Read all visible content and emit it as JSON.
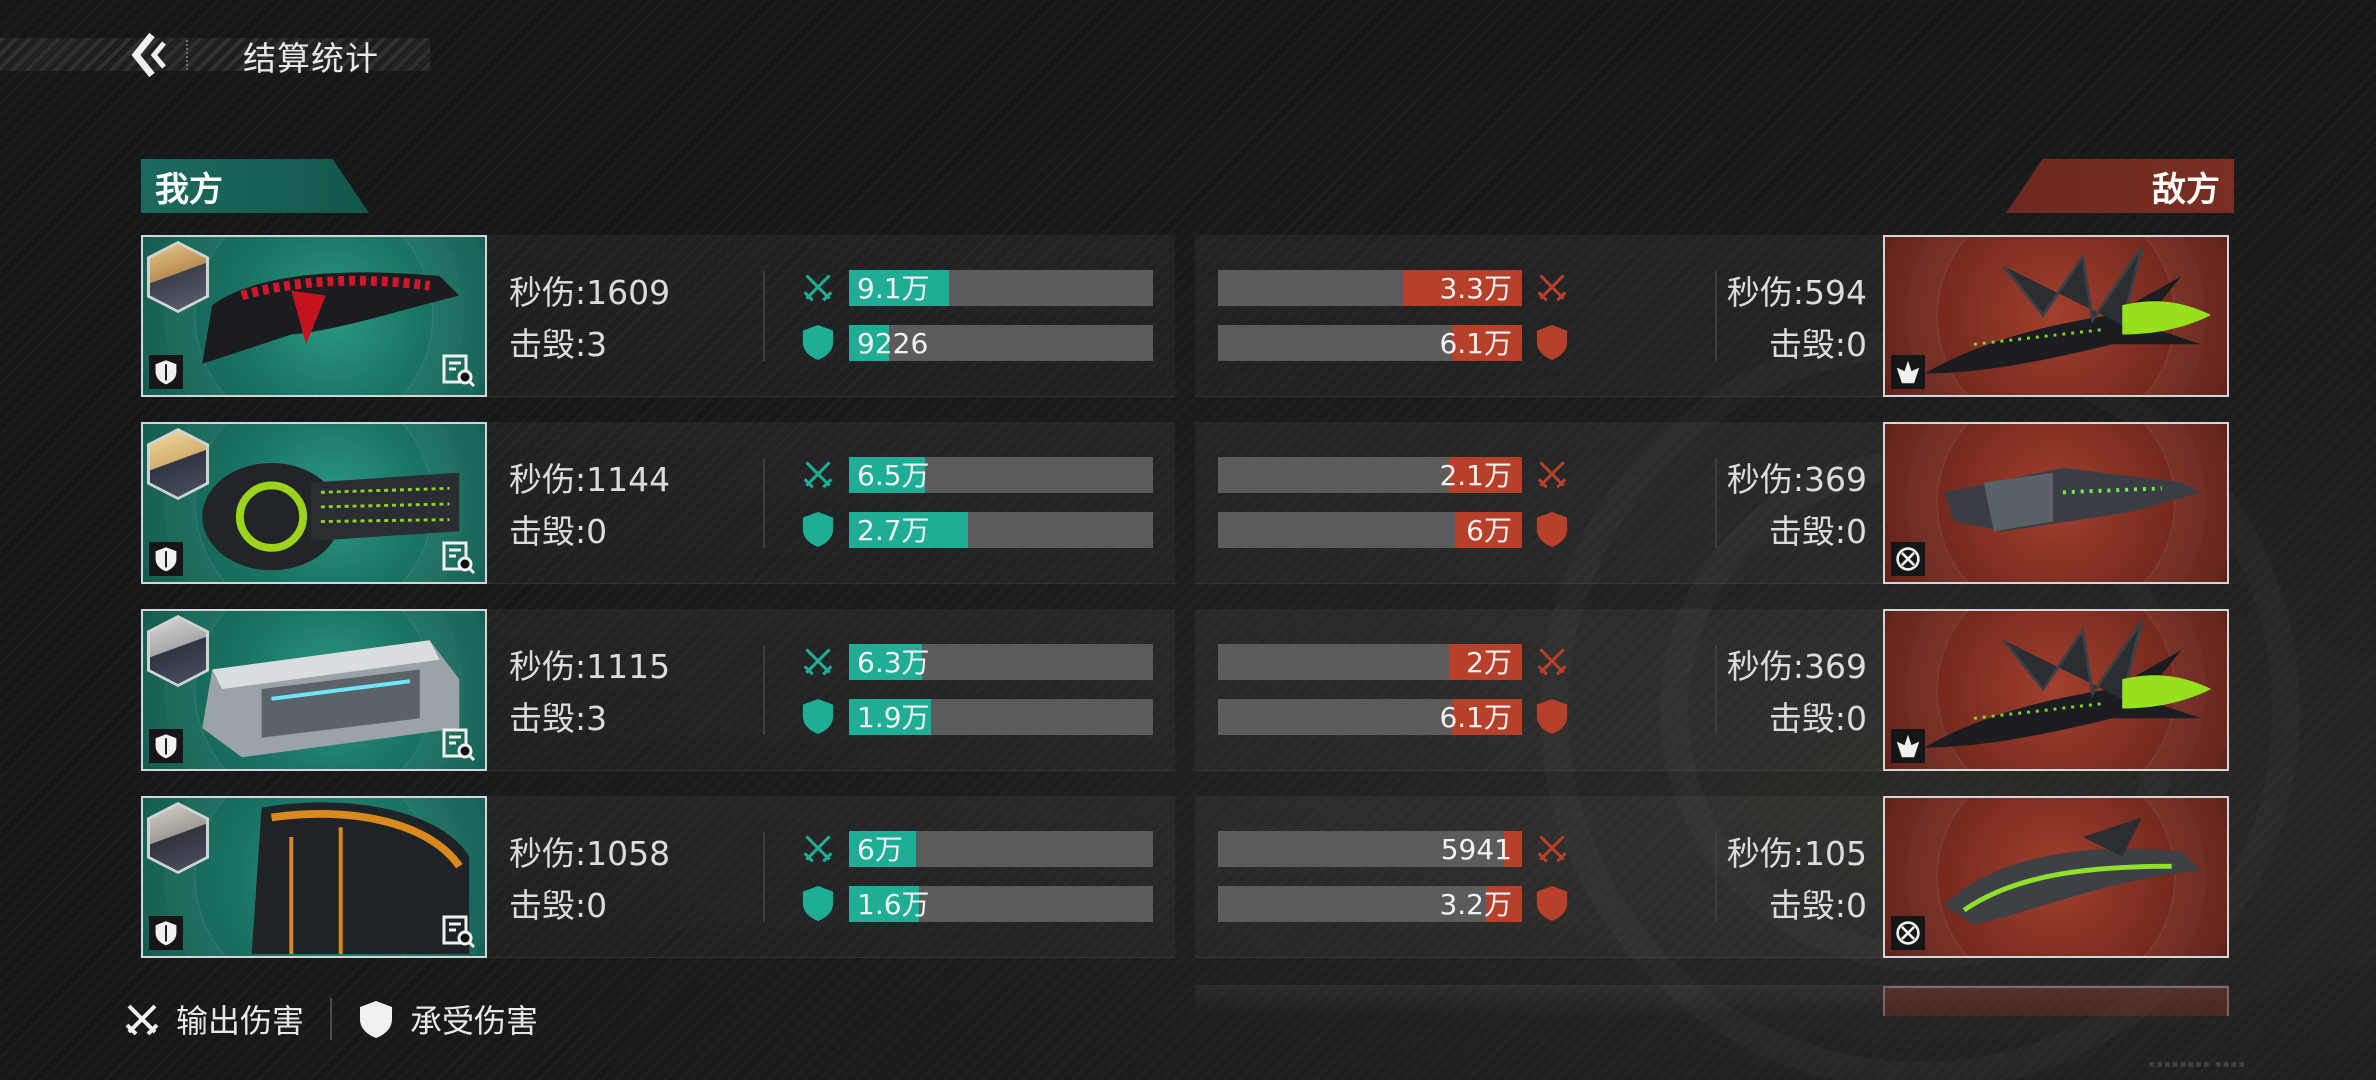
{
  "header": {
    "title": "结算统计"
  },
  "tabs": {
    "ally": "我方",
    "enemy": "敌方"
  },
  "rows": [
    {
      "ally": {
        "dps": "秒伤:1609",
        "kills": "击毁:3",
        "output_label": "9.1万",
        "output_ratio": 0.33,
        "taken_label": "9226",
        "taken_ratio": 0.13
      },
      "enemy": {
        "dps": "秒伤:594",
        "kills": "击毁:0",
        "output_label": "3.3万",
        "output_ratio": 0.39,
        "taken_label": "6.1万",
        "taken_ratio": 0.23,
        "badge": "rank-icon"
      }
    },
    {
      "ally": {
        "dps": "秒伤:1144",
        "kills": "击毁:0",
        "output_label": "6.5万",
        "output_ratio": 0.25,
        "taken_label": "2.7万",
        "taken_ratio": 0.39
      },
      "enemy": {
        "dps": "秒伤:369",
        "kills": "击毁:0",
        "output_label": "2.1万",
        "output_ratio": 0.24,
        "taken_label": "6万",
        "taken_ratio": 0.22,
        "badge": "target-icon"
      }
    },
    {
      "ally": {
        "dps": "秒伤:1115",
        "kills": "击毁:3",
        "output_label": "6.3万",
        "output_ratio": 0.24,
        "taken_label": "1.9万",
        "taken_ratio": 0.27
      },
      "enemy": {
        "dps": "秒伤:369",
        "kills": "击毁:0",
        "output_label": "2万",
        "output_ratio": 0.24,
        "taken_label": "6.1万",
        "taken_ratio": 0.23,
        "badge": "rank-icon"
      }
    },
    {
      "ally": {
        "dps": "秒伤:1058",
        "kills": "击毁:0",
        "output_label": "6万",
        "output_ratio": 0.22,
        "taken_label": "1.6万",
        "taken_ratio": 0.23
      },
      "enemy": {
        "dps": "秒伤:105",
        "kills": "击毁:0",
        "output_label": "5941",
        "output_ratio": 0.06,
        "taken_label": "3.2万",
        "taken_ratio": 0.12,
        "badge": "target-icon"
      }
    }
  ],
  "legend": {
    "output": "输出伤害",
    "taken": "承受伤害"
  },
  "colors": {
    "ally_fill": "#1fae95",
    "enemy_fill": "#b6402a",
    "ally_card": "#1a7463",
    "enemy_card": "#7d2d20"
  }
}
